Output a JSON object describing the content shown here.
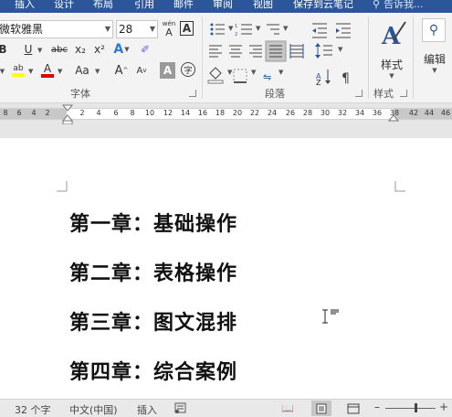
{
  "ribbon_tabs": [
    "插入",
    "设计",
    "布局",
    "引用",
    "邮件",
    "审阅",
    "视图",
    "保存到云笔记"
  ],
  "tell_me": "告诉我...",
  "font": {
    "name": "微软雅黑",
    "size": "28",
    "group_label": "字体",
    "buttons": {
      "underline": "U",
      "strikethrough": "abc",
      "subscript": "x₂",
      "superscript": "x²",
      "highlight": "ab",
      "font_color": "A",
      "change_case": "Aa",
      "grow_font": "A",
      "shrink_font": "A",
      "phonetic": "wén",
      "char_border": "A",
      "char_shading": "A",
      "enclosed": "字"
    }
  },
  "paragraph": {
    "group_label": "段落"
  },
  "styles": {
    "label": "样式",
    "group_label": "样式"
  },
  "editing": {
    "label": "编辑"
  },
  "ruler": {
    "left_ticks": [
      "8",
      "6",
      "4",
      "2"
    ],
    "ticks": [
      "2",
      "4",
      "6",
      "8",
      "10",
      "12",
      "14",
      "16",
      "18",
      "20",
      "22",
      "24",
      "26",
      "28",
      "30",
      "32",
      "34",
      "36",
      "38"
    ],
    "right_ticks": [
      "42",
      "44",
      "46"
    ]
  },
  "document": {
    "headings": [
      "第一章：基础操作",
      "第二章：表格操作",
      "第三章：图文混排",
      "第四章：综合案例"
    ]
  },
  "status_bar": {
    "word_count": "32 个字",
    "language": "中文(中国)",
    "mode": "插入"
  },
  "colors": {
    "ribbon_tab_bar": "#2b579a",
    "highlight": "#ffff00",
    "font_color": "#e00000"
  }
}
